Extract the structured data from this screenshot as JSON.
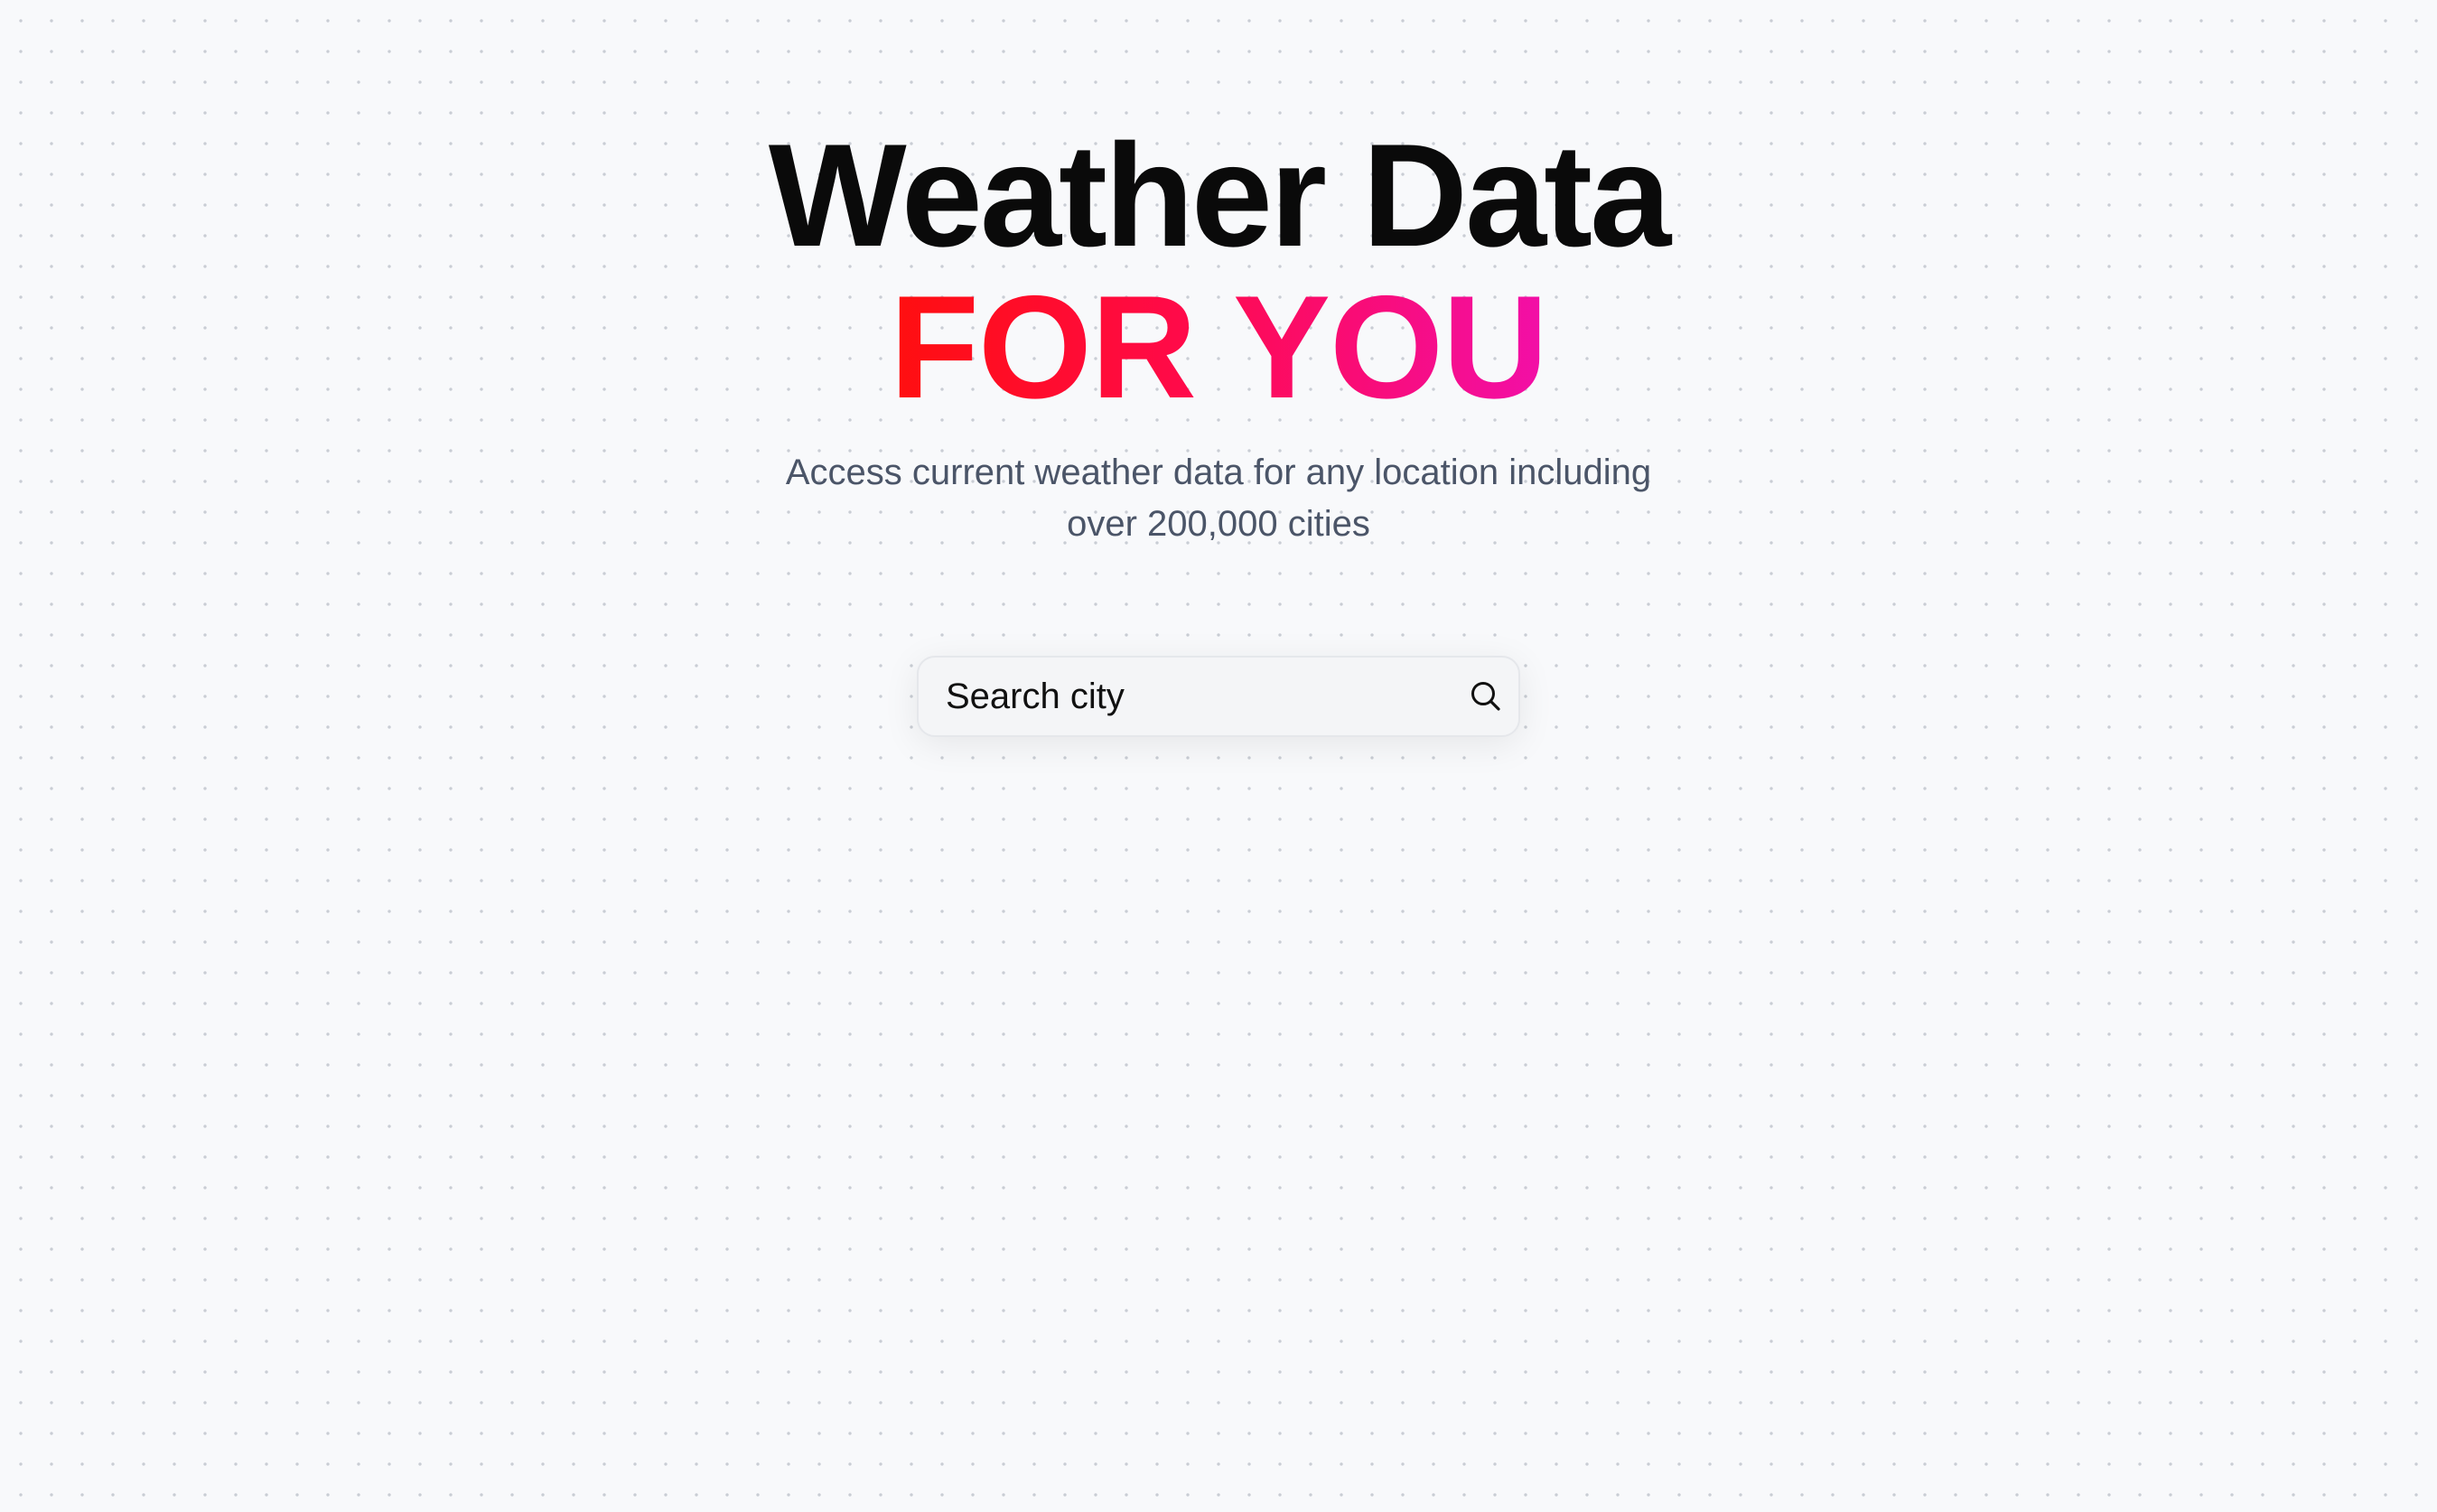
{
  "hero": {
    "title_line_1": "Weather Data",
    "title_line_2": "FOR YOU",
    "subtitle": "Access current weather data for any location including over 200,000 cities"
  },
  "search": {
    "placeholder": "Search city",
    "value": "",
    "icon": "search-icon"
  },
  "colors": {
    "background": "#f8f9fb",
    "title": "#0a0a0a",
    "gradient_start": "#ff0f0f",
    "gradient_end": "#f20fa8",
    "subtitle": "#4b5568"
  }
}
